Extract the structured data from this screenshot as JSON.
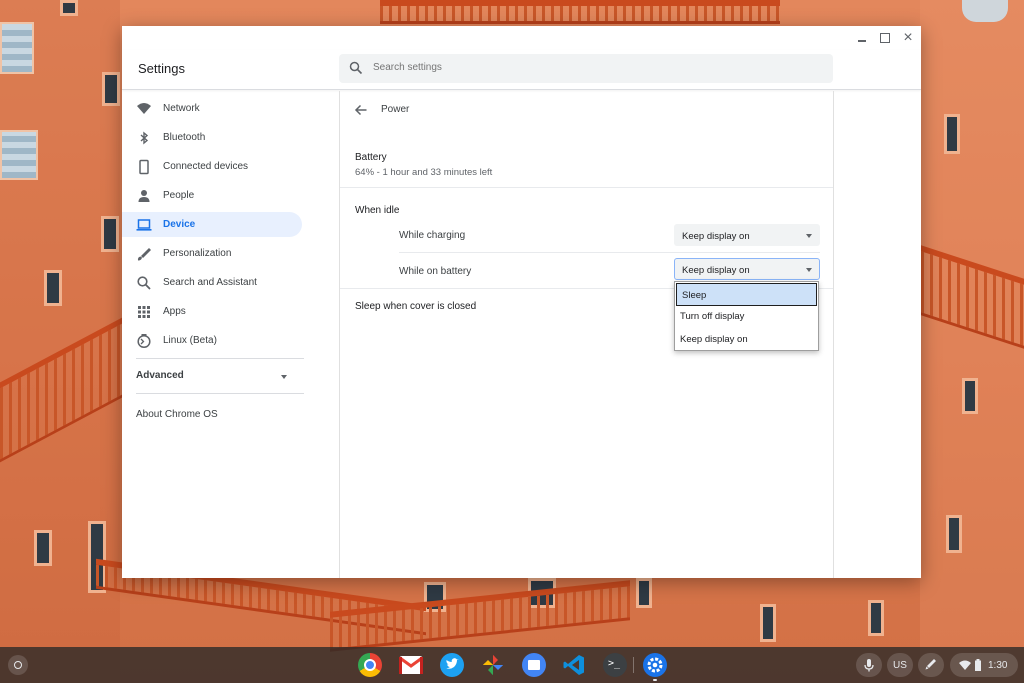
{
  "window": {
    "app_title": "Settings",
    "controls": {
      "minimize": "minimize",
      "maximize": "maximize",
      "close": "×"
    }
  },
  "search": {
    "placeholder": "Search settings",
    "icon": "search-icon"
  },
  "sidebar": {
    "items": [
      {
        "label": "Network",
        "icon": "wifi-icon"
      },
      {
        "label": "Bluetooth",
        "icon": "bluetooth-icon"
      },
      {
        "label": "Connected devices",
        "icon": "phone-icon"
      },
      {
        "label": "People",
        "icon": "person-icon"
      },
      {
        "label": "Device",
        "icon": "laptop-icon",
        "active": true
      },
      {
        "label": "Personalization",
        "icon": "brush-icon"
      },
      {
        "label": "Search and Assistant",
        "icon": "search-icon"
      },
      {
        "label": "Apps",
        "icon": "apps-grid-icon"
      },
      {
        "label": "Linux (Beta)",
        "icon": "linux-icon"
      }
    ],
    "advanced_label": "Advanced",
    "about_label": "About Chrome OS"
  },
  "page": {
    "title": "Power",
    "battery": {
      "heading": "Battery",
      "status": "64% - 1 hour and 33 minutes left"
    },
    "when_idle": {
      "heading": "When idle",
      "rows": [
        {
          "label": "While charging",
          "value": "Keep display on"
        },
        {
          "label": "While on battery",
          "value": "Keep display on"
        }
      ]
    },
    "sleep_cover_label": "Sleep when cover is closed",
    "dropdown_options": [
      "Sleep",
      "Turn off display",
      "Keep display on"
    ],
    "dropdown_highlighted": "Sleep"
  },
  "shelf": {
    "apps": [
      "chrome-icon",
      "gmail-icon",
      "twitter-icon",
      "photos-icon",
      "files-icon",
      "vscode-icon",
      "terminal-icon",
      "settings-icon"
    ],
    "terminal_glyph": ">_",
    "keyboard_layout": "US",
    "time": "1:30"
  },
  "colors": {
    "accent": "#1a73e8",
    "active_bg": "#e8f0fe",
    "shelf": "#282828"
  }
}
